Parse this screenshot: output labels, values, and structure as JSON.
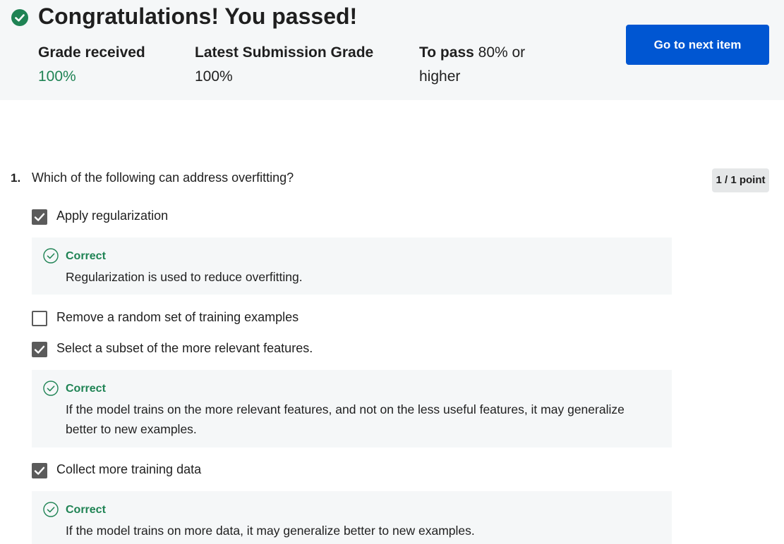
{
  "banner": {
    "headline": "Congratulations! You passed!",
    "grade_label": "Grade received",
    "grade_value": "100%",
    "latest_label": "Latest Submission Grade",
    "latest_value": "100%",
    "pass_label": "To pass",
    "pass_value": "80% or higher",
    "next_button": "Go to next item"
  },
  "question": {
    "number": "1.",
    "text": "Which of the following can address overfitting?",
    "points": "1 / 1 point",
    "options": [
      {
        "label": "Apply regularization",
        "checked": true
      },
      {
        "label": "Remove a random set of training examples",
        "checked": false
      },
      {
        "label": "Select a subset of the more relevant features.",
        "checked": true
      },
      {
        "label": "Collect more training data",
        "checked": true
      }
    ],
    "feedback": [
      {
        "title": "Correct",
        "text": "Regularization is used to reduce overfitting."
      },
      {
        "title": "Correct",
        "text": "If the model trains on the more relevant features, and not on the less useful features, it may generalize better to new examples."
      },
      {
        "title": "Correct",
        "text": "If the model trains on more data, it may generalize better to new examples."
      }
    ]
  },
  "colors": {
    "accent_green": "#1f8354",
    "primary_blue": "#0056d2",
    "banner_bg": "#f5f7f8",
    "checkbox_gray": "#5b5b5b"
  }
}
